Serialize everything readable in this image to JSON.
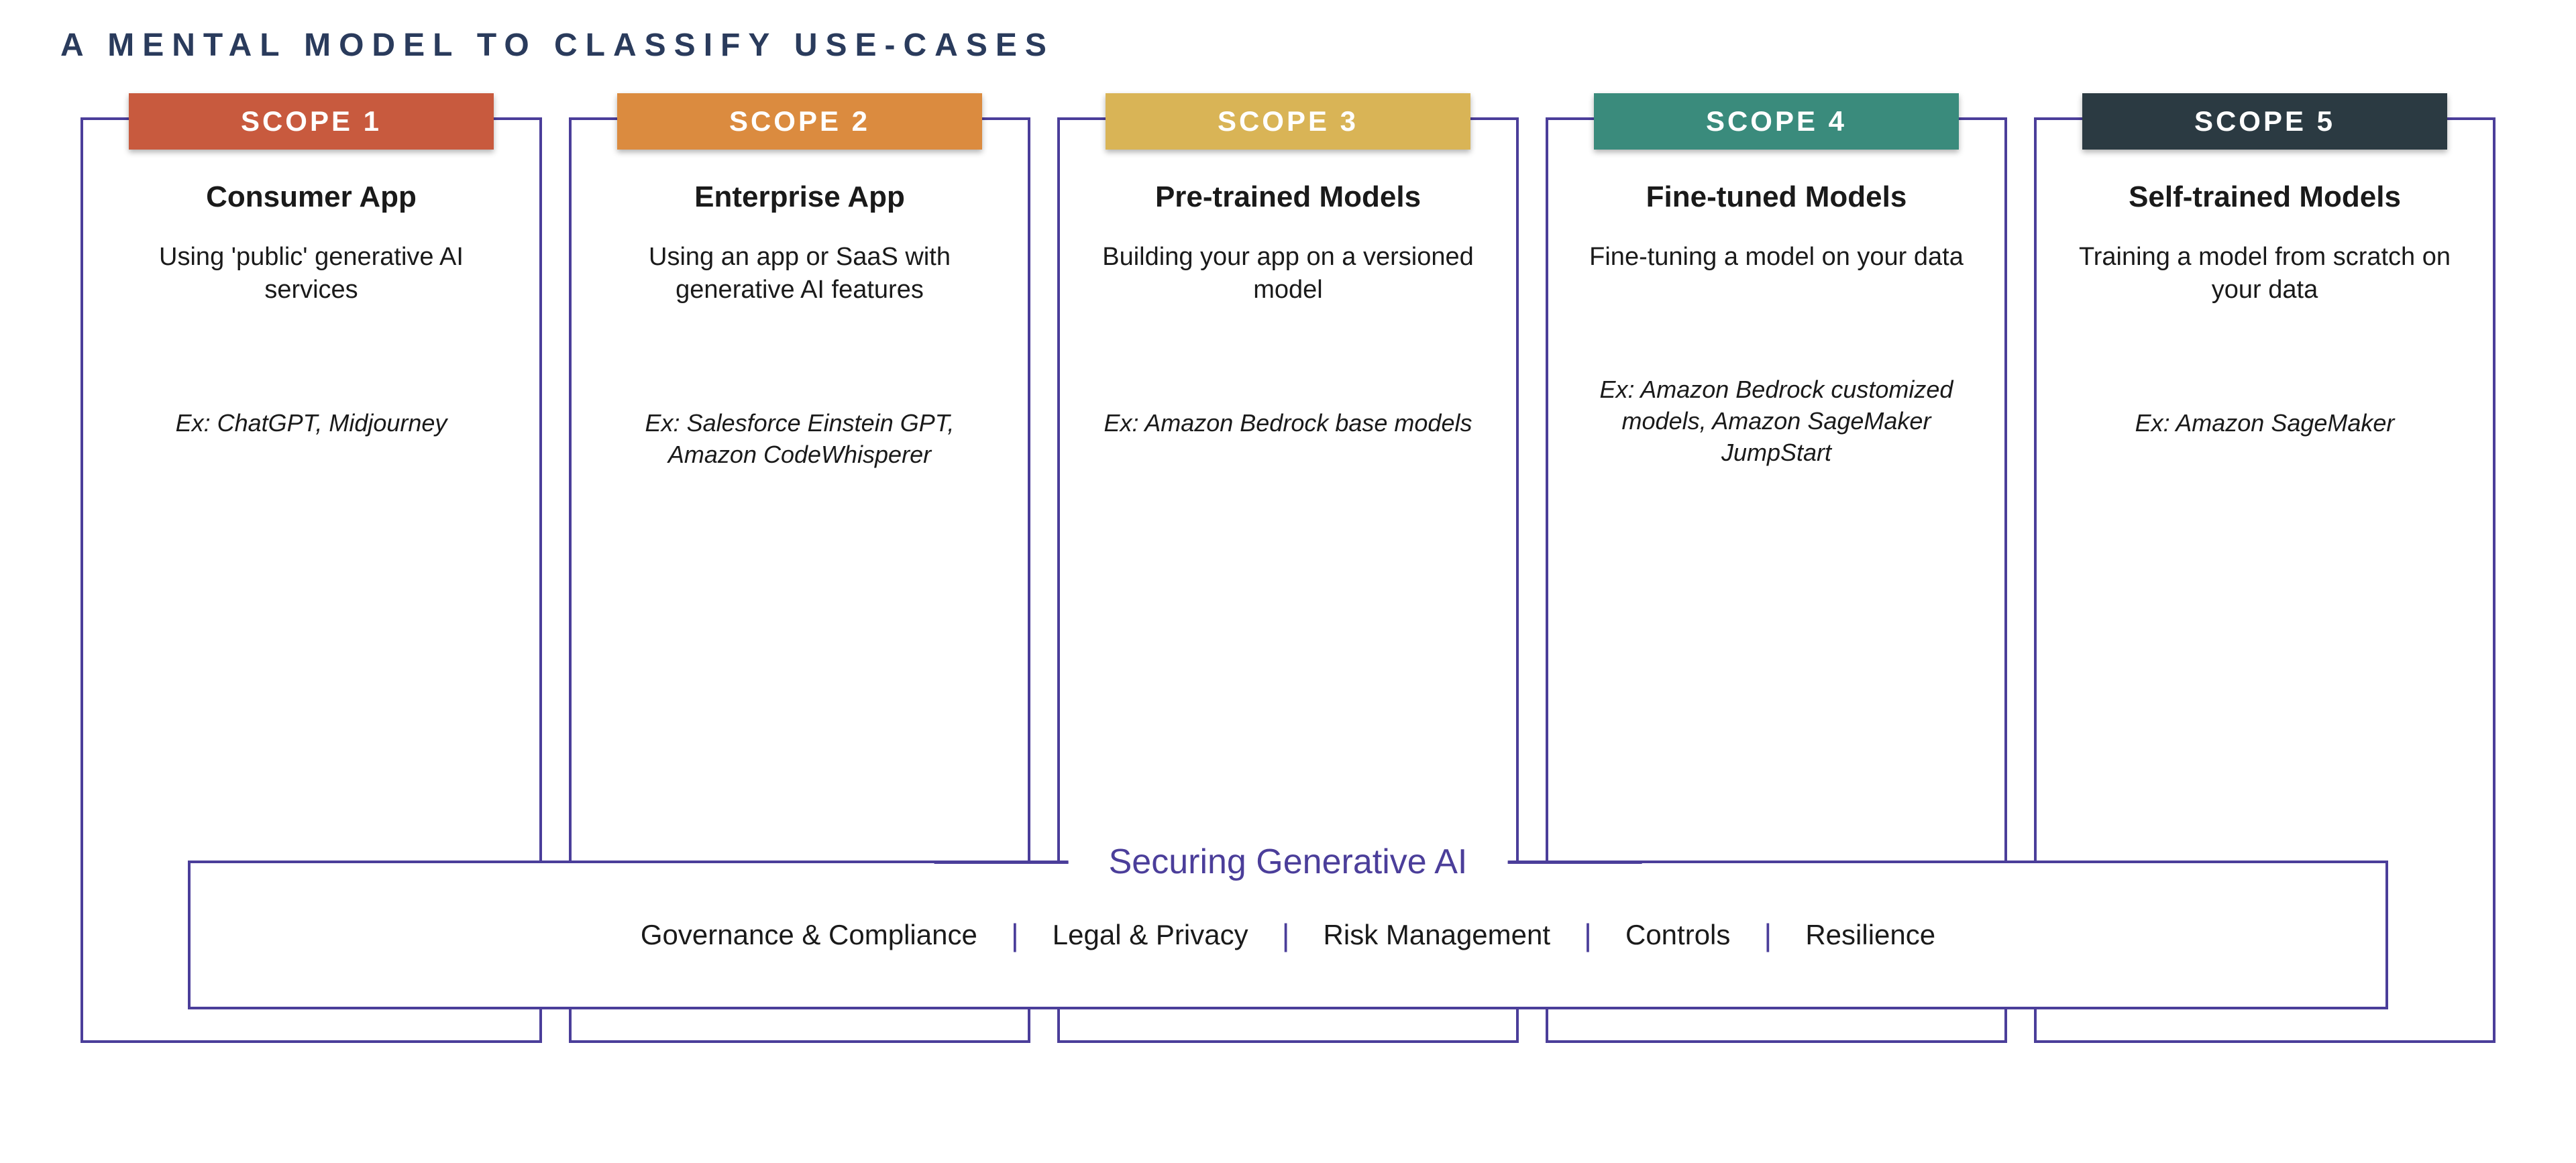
{
  "subtitle": "A MENTAL MODEL TO CLASSIFY USE-CASES",
  "scopes": [
    {
      "header": "SCOPE 1",
      "title": "Consumer App",
      "desc": "Using 'public' generative AI services",
      "example": "Ex: ChatGPT, Midjourney"
    },
    {
      "header": "SCOPE 2",
      "title": "Enterprise App",
      "desc": "Using an app or SaaS with generative AI features",
      "example": "Ex: Salesforce Einstein GPT, Amazon CodeWhisperer"
    },
    {
      "header": "SCOPE 3",
      "title": "Pre-trained Models",
      "desc": "Building your app on a versioned model",
      "example": "Ex: Amazon Bedrock base models"
    },
    {
      "header": "SCOPE 4",
      "title": "Fine-tuned Models",
      "desc": "Fine-tuning a model on your data",
      "example": "Ex: Amazon Bedrock customized models, Amazon SageMaker JumpStart"
    },
    {
      "header": "SCOPE 5",
      "title": "Self-trained Models",
      "desc": "Training a model from scratch on your data",
      "example": "Ex: Amazon SageMaker"
    }
  ],
  "securing": {
    "title": "Securing Generative AI",
    "items": [
      "Governance & Compliance",
      "Legal & Privacy",
      "Risk Management",
      "Controls",
      "Resilience"
    ]
  }
}
